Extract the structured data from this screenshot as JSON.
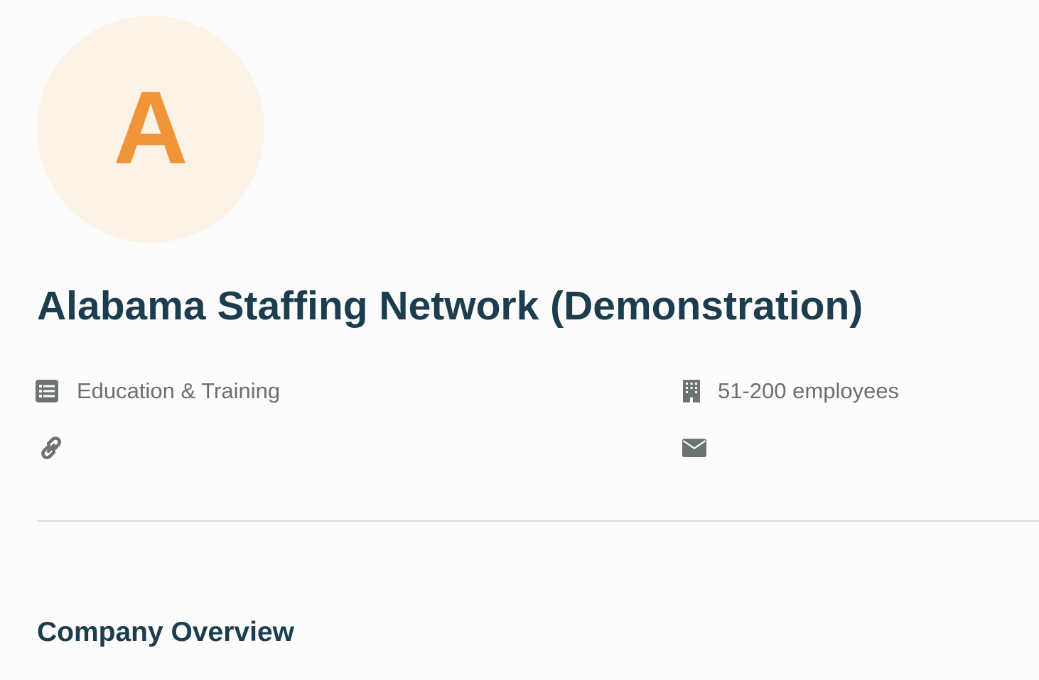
{
  "company": {
    "avatar_letter": "A",
    "name": "Alabama Staffing Network (Demonstration)",
    "industry": "Education & Training",
    "size": "51-200 employees"
  },
  "icons": {
    "industry": "list-icon",
    "size": "building-icon",
    "website": "link-icon",
    "email": "envelope-icon"
  },
  "sections": {
    "overview_heading": "Company Overview"
  },
  "colors": {
    "avatar_bg": "#fdf2e6",
    "avatar_letter": "#f0943a",
    "heading": "#1b3d4e",
    "muted_text": "#6d6f70",
    "icon": "#6b7375"
  }
}
